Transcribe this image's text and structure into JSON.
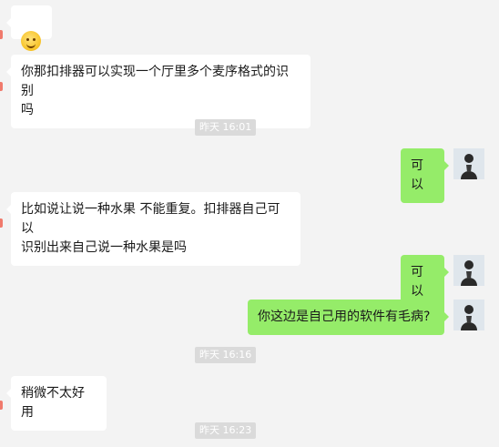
{
  "messages": [
    {
      "side": "left",
      "kind": "emoji",
      "emoji": "slightly-smiling-face-icon"
    },
    {
      "side": "left",
      "kind": "text",
      "text": "你那扣排器可以实现一个厅里多个麦序格式的识别\n吗"
    },
    {
      "kind": "time",
      "text": "昨天 16:01"
    },
    {
      "side": "right",
      "kind": "text",
      "text": "可以"
    },
    {
      "side": "left",
      "kind": "text",
      "text": "比如说让说一种水果 不能重复。扣排器自己可以\n识别出来自己说一种水果是吗"
    },
    {
      "side": "right",
      "kind": "text",
      "text": "可以"
    },
    {
      "side": "right",
      "kind": "text",
      "text": "你这边是自己用的软件有毛病?"
    },
    {
      "kind": "time",
      "text": "昨天 16:16"
    },
    {
      "side": "left",
      "kind": "text",
      "text": "稍微不太好用"
    },
    {
      "kind": "time",
      "text": "昨天 16:23"
    }
  ],
  "colors": {
    "background": "#f3f3f3",
    "left_bubble": "#ffffff",
    "right_bubble": "#95ec69",
    "timestamp_bg": "#dadada",
    "edge_marker": "#f07a6c"
  }
}
